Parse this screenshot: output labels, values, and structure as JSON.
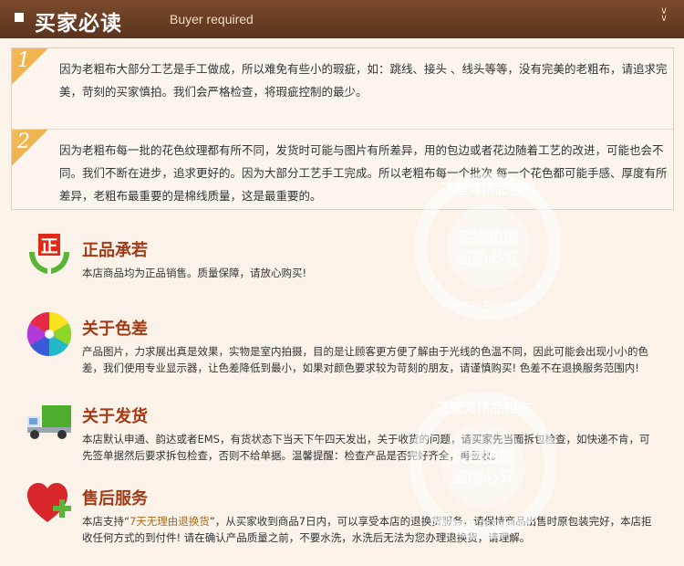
{
  "header": {
    "title": "买家必读",
    "subtitle": "Buyer required"
  },
  "notes": [
    {
      "num": "1",
      "text": "因为老粗布大部分工艺是手工做成，所以难免有些小的瑕疵，如：跳线、接头 、线头等等，没有完美的老粗布，请追求完美，苛刻的买家慎拍。我们会严格检查，将瑕疵控制的最少。"
    },
    {
      "num": "2",
      "text": "因为老粗布每一批的花色纹理都有所不同，发货时可能与图片有所差异，用的包边或者花边随着工艺的改进，可能也会不同。我们不断在进步，追求更好的。因为大部分工艺手工完成。所以老粗布每一个批次 每一个花色都可能手感、厚度有所差异，老粗布最重要的是棉线质量，这是最重要的。"
    }
  ],
  "items": [
    {
      "title": "正品承若",
      "text": "本店商品均为正品销售。质量保障，请放心购买!"
    },
    {
      "title": "关于色差",
      "text": "产品图片，力求展出真是效果，实物是室内拍摄，目的是让顾客更方便了解由于光线的色温不同，因此可能会出现小小的色差，我们使用专业显示器，让色差降低到最小，如果对颜色要求较为苛刻的朋友，请谨慎购买! 色差不在退换服务范围内!"
    },
    {
      "title": "关于发货",
      "text": "本店默认申通、韵达或者EMS，有货状态下当天下午四天发出，关于收货的问题，请买家先当面拆包检查，如快递不肯，可先签单据然后要求拆包检查，否则不给单据。温馨提醒：检查产品是否完好齐全，再签收。"
    },
    {
      "title": "售后服务",
      "text_a": "本店支持“",
      "text_highlight": "7天无理由退换货",
      "text_b": "”，从买家收到商品7日内，可以享受本店的退换货服务，请保持商品出售时原包装完好，本店拒收任何方式的到付件! 请在确认产品质量之前，不要水洗，水洗后无法为您办理退换货，请理解。"
    }
  ],
  "watermark": {
    "ring": "飞雁滩精品粗布",
    "center1": "实物拍摄",
    "center2": "盗图必究",
    "bottom": "feiyantan.taobao.com"
  },
  "icons": {
    "1": "zheng-hands-icon",
    "2": "color-wheel-icon",
    "3": "truck-icon",
    "4": "heart-plus-icon"
  }
}
